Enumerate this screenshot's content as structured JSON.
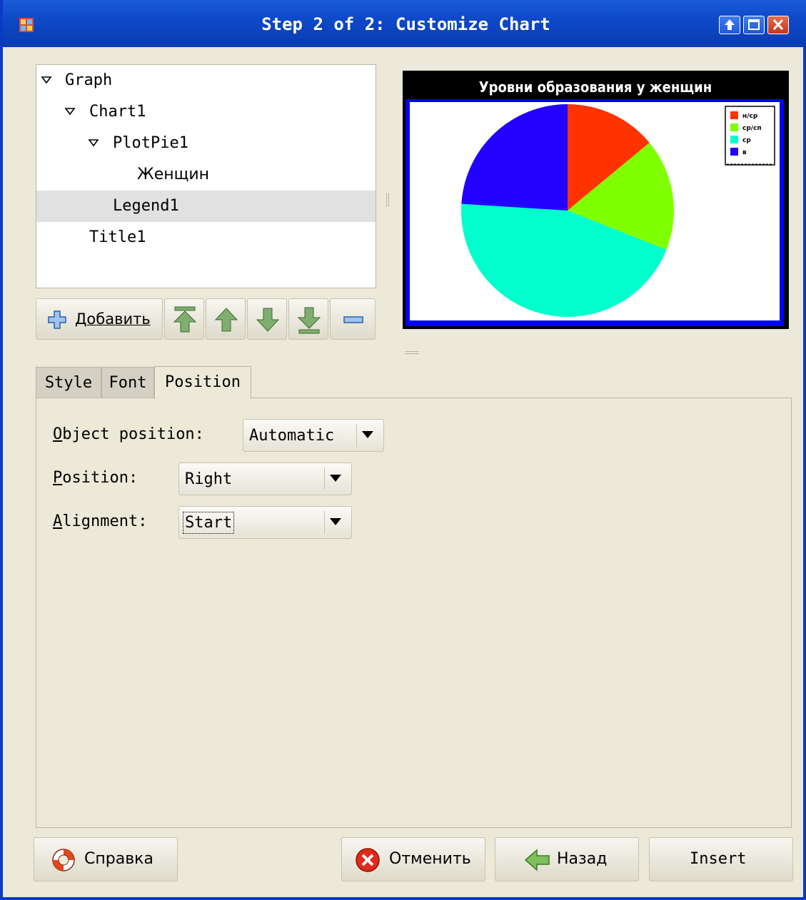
{
  "window": {
    "title": "Step 2 of 2: Customize Chart"
  },
  "tree": {
    "items": [
      {
        "label": "Graph",
        "expanded": true,
        "level": 0
      },
      {
        "label": "Chart1",
        "expanded": true,
        "level": 1
      },
      {
        "label": "PlotPie1",
        "expanded": true,
        "level": 2
      },
      {
        "label": "Женщин",
        "level": 3
      },
      {
        "label": "Legend1",
        "level": 2,
        "selected": true
      },
      {
        "label": "Title1",
        "level": 1
      }
    ]
  },
  "toolbar": {
    "add_label": "Добавить",
    "icons": [
      "add-icon",
      "move-top-icon",
      "move-up-icon",
      "move-down-icon",
      "move-bottom-icon",
      "remove-icon"
    ]
  },
  "preview": {
    "chart_data": {
      "type": "pie",
      "title": "Уровни образования у женщин",
      "categories": [
        "н/ср",
        "ср/сп",
        "ср",
        "в"
      ],
      "values": [
        14,
        17,
        45,
        24
      ],
      "colors": [
        "#ff3300",
        "#80ff00",
        "#00ffcc",
        "#2200ff"
      ],
      "legend": "top-right"
    }
  },
  "tabs": [
    {
      "label": "Style",
      "active": false
    },
    {
      "label": "Font",
      "active": false
    },
    {
      "label": "Position",
      "active": true
    }
  ],
  "position_tab": {
    "object_position": {
      "label": "Object position:",
      "mnemonic": "O",
      "value": "Automatic"
    },
    "position": {
      "label": "Position:",
      "mnemonic": "P",
      "value": "Right"
    },
    "alignment": {
      "label": "Alignment:",
      "mnemonic": "A",
      "value": "Start"
    }
  },
  "buttons": {
    "help": "Справка",
    "cancel": "Отменить",
    "back": "Назад",
    "insert": "Insert"
  },
  "colors": {
    "titlebar": "#0d49c8",
    "dialog_bg": "#ece9d8",
    "selection_bg": "#e1e1e1"
  }
}
